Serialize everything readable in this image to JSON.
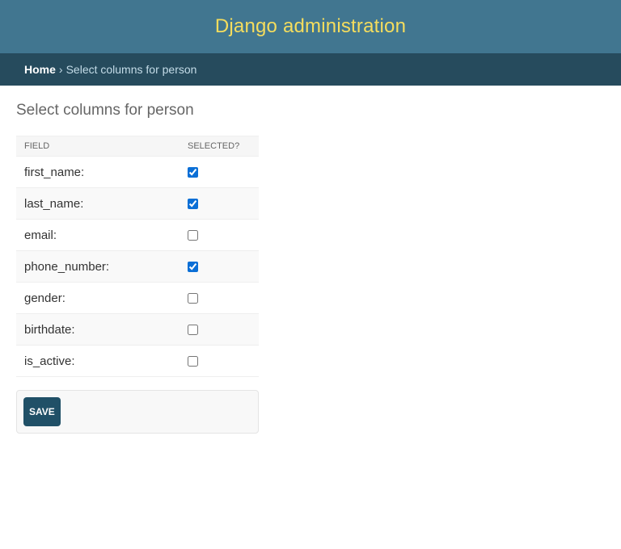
{
  "header": {
    "site_name": "Django administration"
  },
  "breadcrumbs": {
    "home": "Home",
    "separator": "›",
    "current": "Select columns for person"
  },
  "page": {
    "title": "Select columns for person"
  },
  "table": {
    "headers": {
      "field": "FIELD",
      "selected": "SELECTED?"
    },
    "rows": [
      {
        "field": "first_name:",
        "selected": true
      },
      {
        "field": "last_name:",
        "selected": true
      },
      {
        "field": "email:",
        "selected": false
      },
      {
        "field": "phone_number:",
        "selected": true
      },
      {
        "field": "gender:",
        "selected": false
      },
      {
        "field": "birthdate:",
        "selected": false
      },
      {
        "field": "is_active:",
        "selected": false
      }
    ]
  },
  "actions": {
    "save_label": "SAVE"
  },
  "colors": {
    "header_bg": "#417690",
    "site_name": "#f5dd5d",
    "breadcrumbs_bg": "#264b5d",
    "button_bg": "#205067",
    "checkbox_accent": "#0b6fd6"
  }
}
